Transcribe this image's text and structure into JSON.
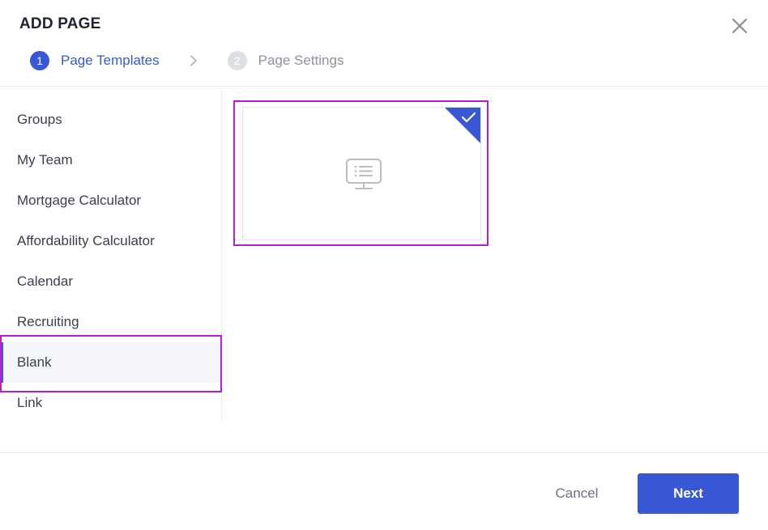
{
  "dialog": {
    "title": "ADD PAGE",
    "close_icon": "close-icon"
  },
  "stepper": {
    "steps": [
      {
        "number": "1",
        "label": "Page Templates",
        "state": "active"
      },
      {
        "number": "2",
        "label": "Page Settings",
        "state": "inactive"
      }
    ],
    "separator_icon": "chevron-right-icon"
  },
  "sidebar": {
    "items": [
      {
        "label": "Groups"
      },
      {
        "label": "My Team"
      },
      {
        "label": "Mortgage Calculator"
      },
      {
        "label": "Affordability Calculator"
      },
      {
        "label": "Calendar"
      },
      {
        "label": "Recruiting"
      },
      {
        "label": "Blank",
        "selected": true
      },
      {
        "label": "Link"
      }
    ],
    "selected_index": 6
  },
  "templates": {
    "cards": [
      {
        "icon": "monitor-list-icon",
        "selected": true,
        "check_icon": "check-icon"
      }
    ]
  },
  "footer": {
    "cancel_label": "Cancel",
    "next_label": "Next"
  },
  "colors": {
    "accent": "#3757d4",
    "highlight": "#b41fcf",
    "selected_bg": "#f4f5f8",
    "text_primary": "#1d2330",
    "text_muted": "#8d929b"
  }
}
